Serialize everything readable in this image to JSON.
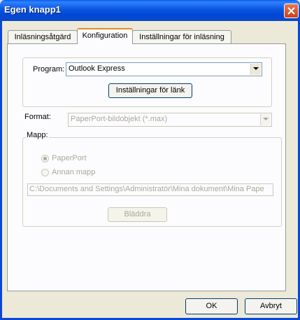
{
  "window": {
    "title": "Egen knapp1"
  },
  "tabs": [
    {
      "label": "Inläsningsåtgärd"
    },
    {
      "label": "Konfiguration"
    },
    {
      "label": "Inställningar för inläsning"
    }
  ],
  "program": {
    "label": "Program:",
    "value": "Outlook Express",
    "link_settings_button": "Inställningar för länk"
  },
  "format": {
    "label": "Format:",
    "value": "PaperPort-bildobjekt (*.max)"
  },
  "folder": {
    "group_label": "Mapp:",
    "option_paperport": "PaperPort",
    "option_other": "Annan mapp",
    "path": "C:\\Documents and Settings\\Administratör\\Mina dokument\\Mina Pape",
    "browse_button": "Bläddra"
  },
  "footer": {
    "ok_button": "OK",
    "cancel_button": "Avbryt"
  }
}
